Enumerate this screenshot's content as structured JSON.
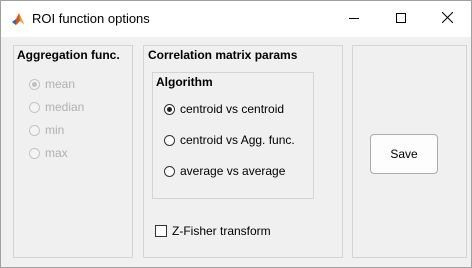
{
  "window": {
    "title": "ROI function options"
  },
  "titlebar": {
    "app_icon": "matlab-icon",
    "minimize_icon": "minimize-icon",
    "maximize_icon": "maximize-icon",
    "close_icon": "close-icon"
  },
  "aggregation": {
    "title": "Aggregation func.",
    "enabled": false,
    "selected": "mean",
    "options": [
      "mean",
      "median",
      "min",
      "max"
    ]
  },
  "correlation": {
    "title": "Correlation matrix params",
    "algorithm": {
      "title": "Algorithm",
      "selected": "centroid vs centroid",
      "options": [
        "centroid vs centroid",
        "centroid vs Agg. func.",
        "average vs average"
      ]
    },
    "z_fisher": {
      "label": "Z-Fisher transform",
      "checked": false
    }
  },
  "actions": {
    "save_label": "Save"
  },
  "colors": {
    "window_bg": "#f0f0f0",
    "titlebar_bg": "#ffffff",
    "panel_border": "#d4d4d4",
    "disabled_text": "#b0b0b0"
  }
}
